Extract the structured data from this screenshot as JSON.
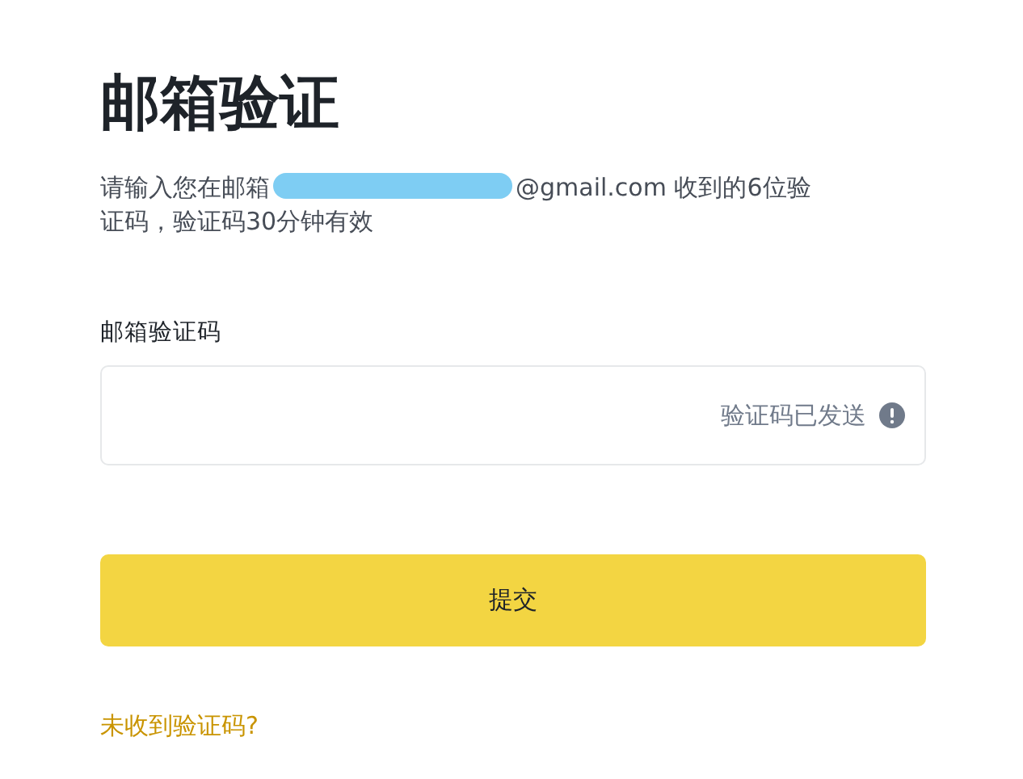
{
  "title": "邮箱验证",
  "description": {
    "before": "请输入您在邮箱",
    "redacted": true,
    "after": "@gmail.com 收到的6位验",
    "second_line": "证码，验证码30分钟有效"
  },
  "field": {
    "label": "邮箱验证码",
    "status": "验证码已发送",
    "alert": true
  },
  "submit_button": "提交",
  "resend_link": "未收到验证码?"
}
